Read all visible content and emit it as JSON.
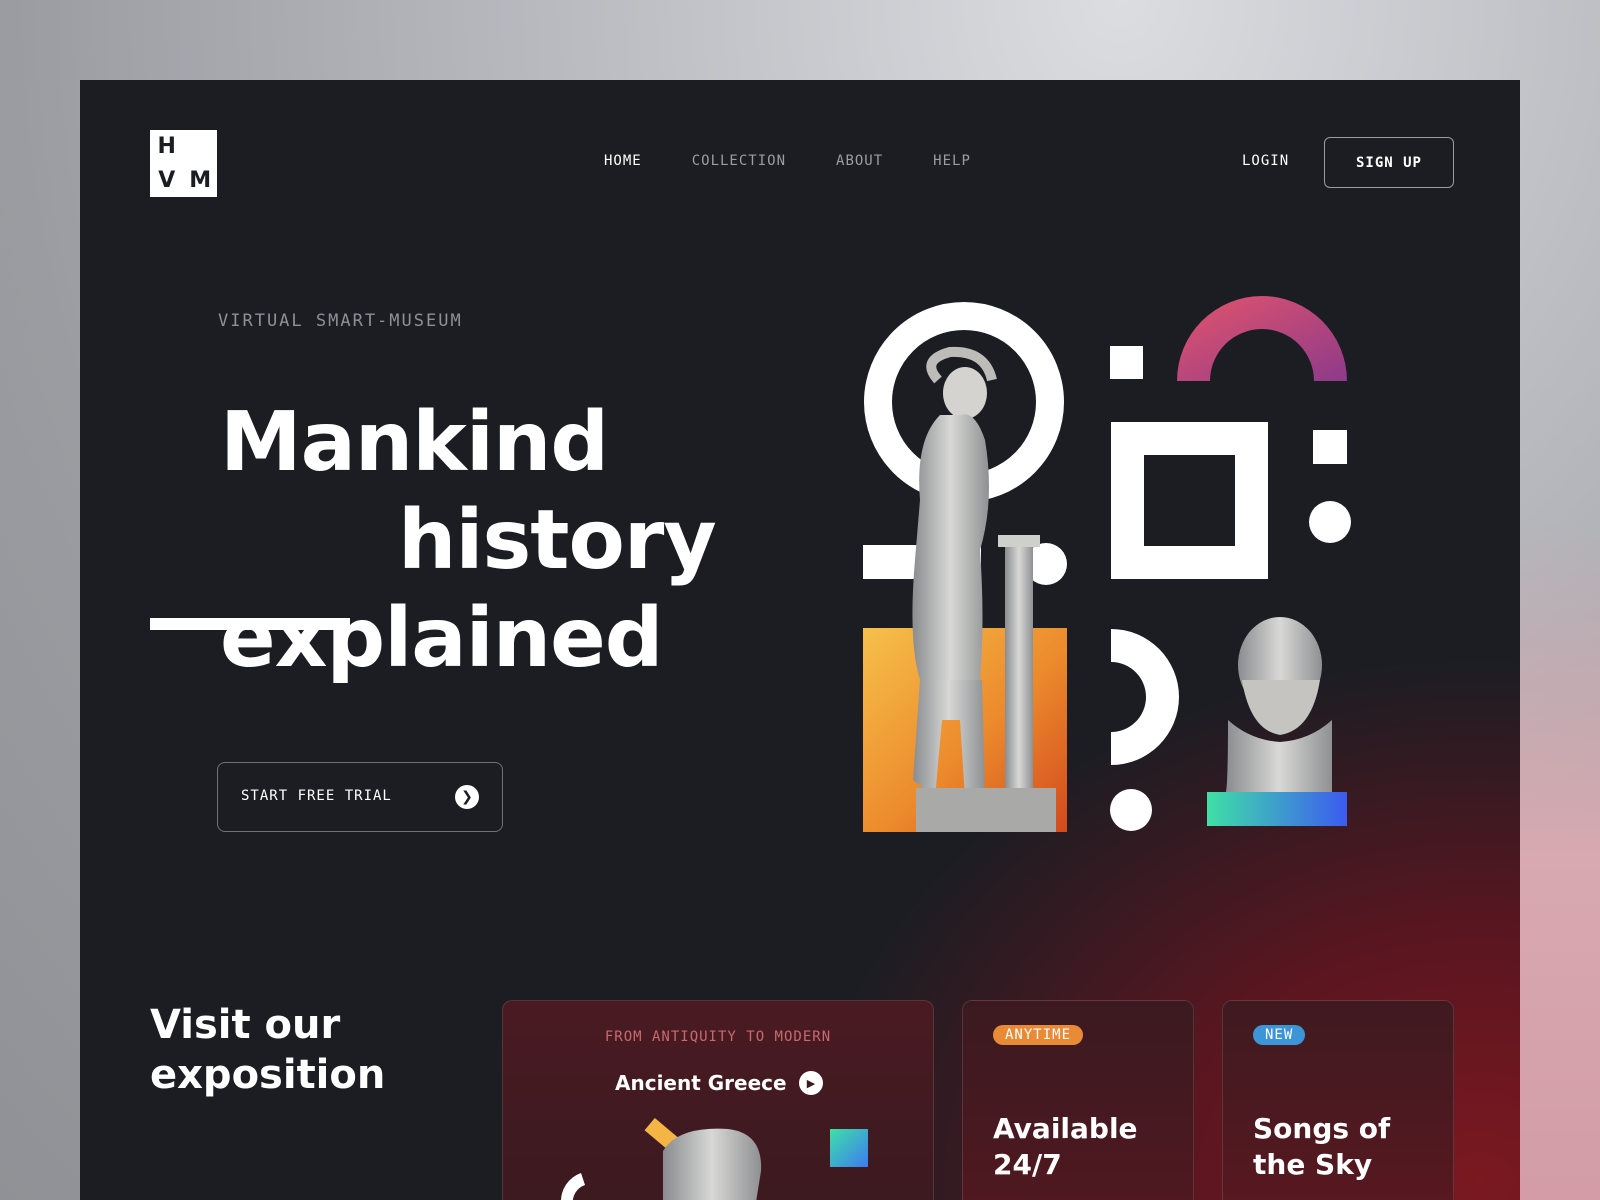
{
  "logo": {
    "letters": [
      "H",
      "",
      "V",
      "M"
    ]
  },
  "nav": {
    "items": [
      "HOME",
      "COLLECTION",
      "ABOUT",
      "HELP"
    ],
    "active": "HOME"
  },
  "auth": {
    "login": "LOGIN",
    "signup": "SIGN UP"
  },
  "hero": {
    "kicker": "VIRTUAL SMART-MUSEUM",
    "title_line1": "Mankind",
    "title_line2": "history",
    "title_line3": "explained",
    "cta_label": "START FREE TRIAL"
  },
  "exposition": {
    "title_line1": "Visit our",
    "title_line2": "exposition",
    "cards": [
      {
        "kicker": "FROM ANTIQUITY TO MODERN",
        "title": "Ancient Greece"
      },
      {
        "badge": "ANYTIME",
        "title_line1": "Available",
        "title_line2": "24/7"
      },
      {
        "badge": "NEW",
        "title_line1": "Songs of",
        "title_line2": "the Sky"
      }
    ]
  },
  "colors": {
    "frame_bg": "#1b1d23",
    "accent_red": "#7b1820",
    "badge_orange": "#e98a36",
    "badge_blue": "#3c95d6",
    "arc_gradient": [
      "#e3546c",
      "#8e3a8a"
    ],
    "block_gradient": [
      "#f4b544",
      "#d54a1f"
    ],
    "pedestal_gradient": [
      "#3fe0a6",
      "#3c5bf0"
    ]
  }
}
